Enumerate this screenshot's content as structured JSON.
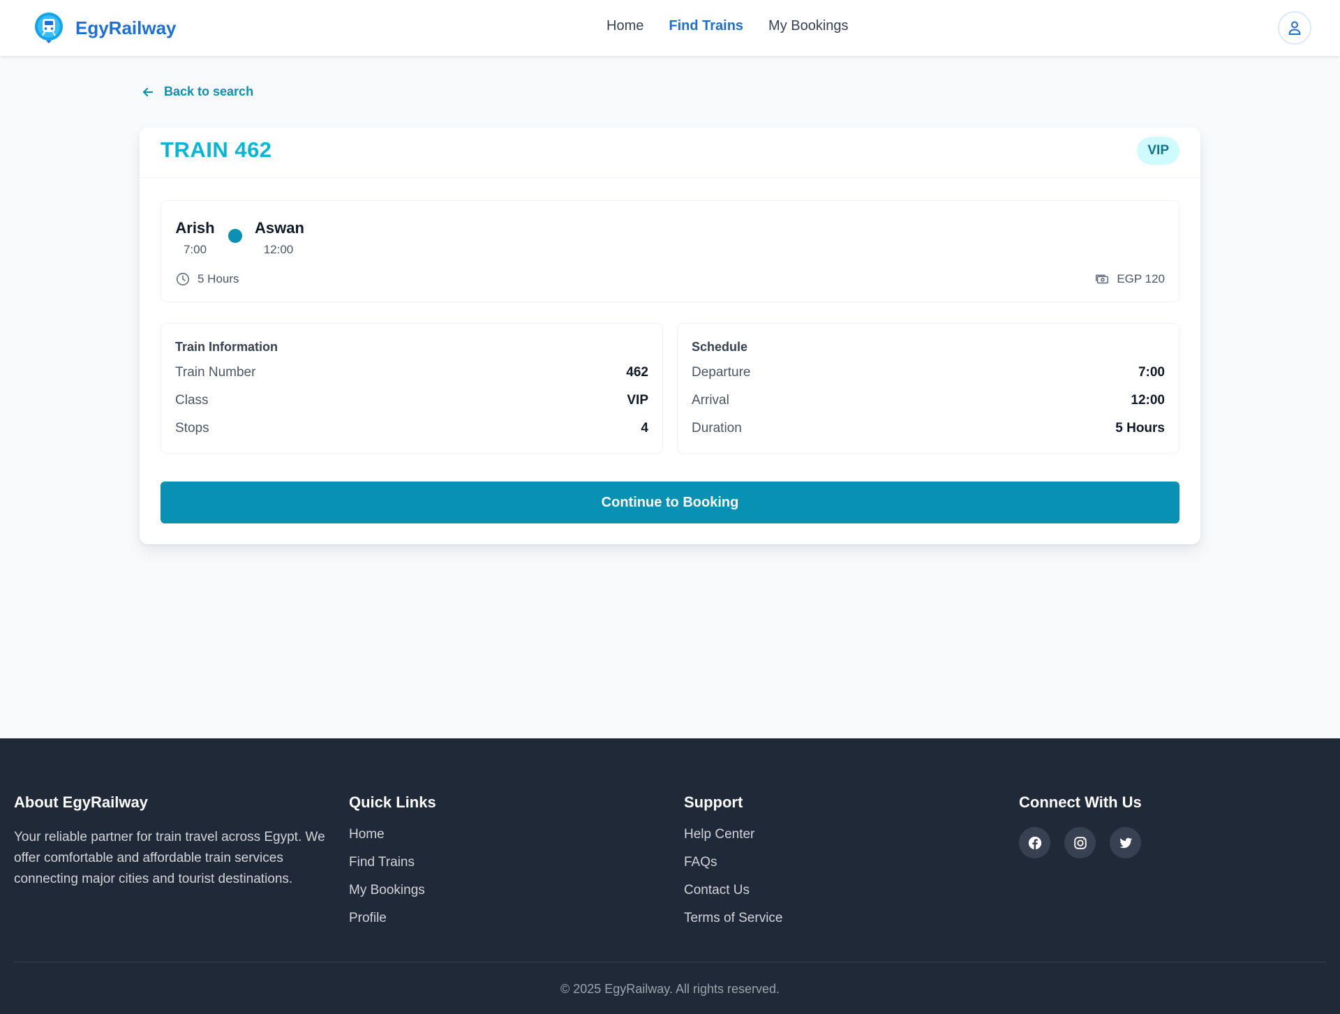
{
  "header": {
    "brand": "EgyRailway",
    "nav": [
      {
        "label": "Home",
        "active": false
      },
      {
        "label": "Find Trains",
        "active": true
      },
      {
        "label": "My Bookings",
        "active": false
      }
    ],
    "profile_icon": "user-icon"
  },
  "back_link": "Back to search",
  "train": {
    "title": "TRAIN 462",
    "class_badge": "VIP",
    "route": {
      "from": {
        "name": "Arish",
        "time": "7:00"
      },
      "to": {
        "name": "Aswan",
        "time": "12:00"
      },
      "duration": "5 Hours",
      "price": "EGP 120"
    },
    "info": {
      "title": "Train Information",
      "rows": [
        {
          "label": "Train Number",
          "value": "462"
        },
        {
          "label": "Class",
          "value": "VIP"
        },
        {
          "label": "Stops",
          "value": "4"
        }
      ]
    },
    "schedule": {
      "title": "Schedule",
      "rows": [
        {
          "label": "Departure",
          "value": "7:00"
        },
        {
          "label": "Arrival",
          "value": "12:00"
        },
        {
          "label": "Duration",
          "value": "5 Hours"
        }
      ]
    },
    "continue_label": "Continue to Booking"
  },
  "footer": {
    "about": {
      "title": "About EgyRailway",
      "text": "Your reliable partner for train travel across Egypt. We offer comfortable and affordable train services connecting major cities and tourist destinations."
    },
    "quick_links": {
      "title": "Quick Links",
      "items": [
        "Home",
        "Find Trains",
        "My Bookings",
        "Profile"
      ]
    },
    "support": {
      "title": "Support",
      "items": [
        "Help Center",
        "FAQs",
        "Contact Us",
        "Terms of Service"
      ]
    },
    "connect": {
      "title": "Connect With Us",
      "icons": [
        "facebook-icon",
        "instagram-icon",
        "twitter-icon"
      ]
    },
    "copyright": "© 2025 EgyRailway. All rights reserved."
  },
  "colors": {
    "brand_blue": "#1d6fd8",
    "accent_cyan": "#0891b2",
    "title_cyan": "#06b6d4",
    "footer_bg": "#1f2937"
  }
}
